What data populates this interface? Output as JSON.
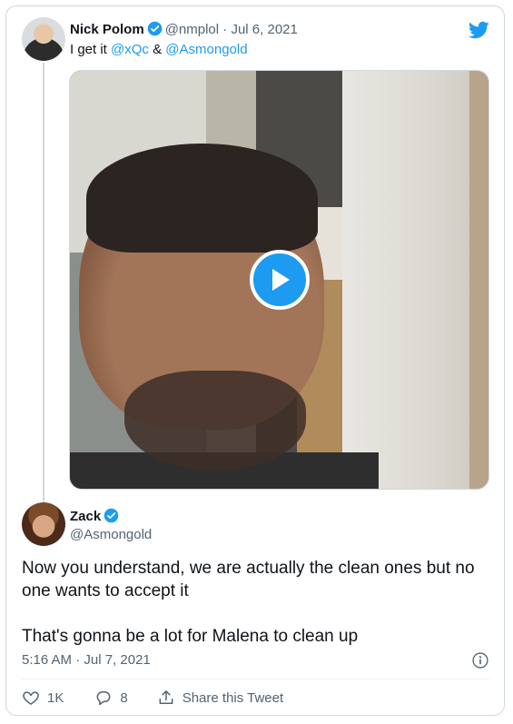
{
  "quoted": {
    "name": "Nick Polom",
    "handle": "@nmplol",
    "separator": "·",
    "date": "Jul 6, 2021",
    "text_prefix": "I get it ",
    "mention1": "@xQc",
    "text_join": " & ",
    "mention2": "@Asmongold"
  },
  "tweet": {
    "name": "Zack",
    "handle": "@Asmongold",
    "paragraph1": "Now you understand, we are actually the clean ones but no one wants to accept it",
    "paragraph2": "That's gonna be a lot for Malena to clean up",
    "time": "5:16 AM",
    "separator": "·",
    "date": "Jul 7, 2021"
  },
  "actions": {
    "likes": "1K",
    "replies": "8",
    "share_label": "Share this Tweet"
  },
  "colors": {
    "accent": "#1d9bf0",
    "muted": "#536471",
    "border": "#cfd9de"
  },
  "icons": [
    "twitter-bird-icon",
    "verified-badge-icon",
    "play-icon",
    "info-icon",
    "heart-icon",
    "reply-icon",
    "share-icon"
  ]
}
